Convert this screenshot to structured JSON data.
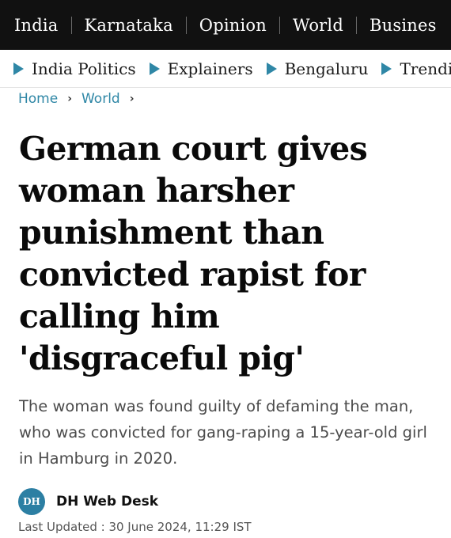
{
  "top_nav": {
    "items": [
      "India",
      "Karnataka",
      "Opinion",
      "World",
      "Busines"
    ]
  },
  "sub_nav": {
    "items": [
      "India Politics",
      "Explainers",
      "Bengaluru",
      "Trendin"
    ],
    "icon": "triangle-right-icon",
    "icon_color": "#2f87a6"
  },
  "breadcrumb": {
    "items": [
      "Home",
      "World"
    ]
  },
  "article": {
    "headline": "German court gives woman harsher punishment than convicted rapist for calling him 'disgraceful pig'",
    "summary": "The woman was found guilty of defaming the man, who was convicted for gang-raping a 15-year-old girl in Hamburg in 2020.",
    "author": {
      "logo_text": "DH",
      "name": "DH Web Desk"
    },
    "last_updated": "Last Updated : 30 June 2024, 11:29 IST"
  },
  "colors": {
    "top_nav_bg": "#111111",
    "accent": "#2f87a6",
    "headline": "#0a0a0a",
    "summary": "#4b4b4b"
  }
}
